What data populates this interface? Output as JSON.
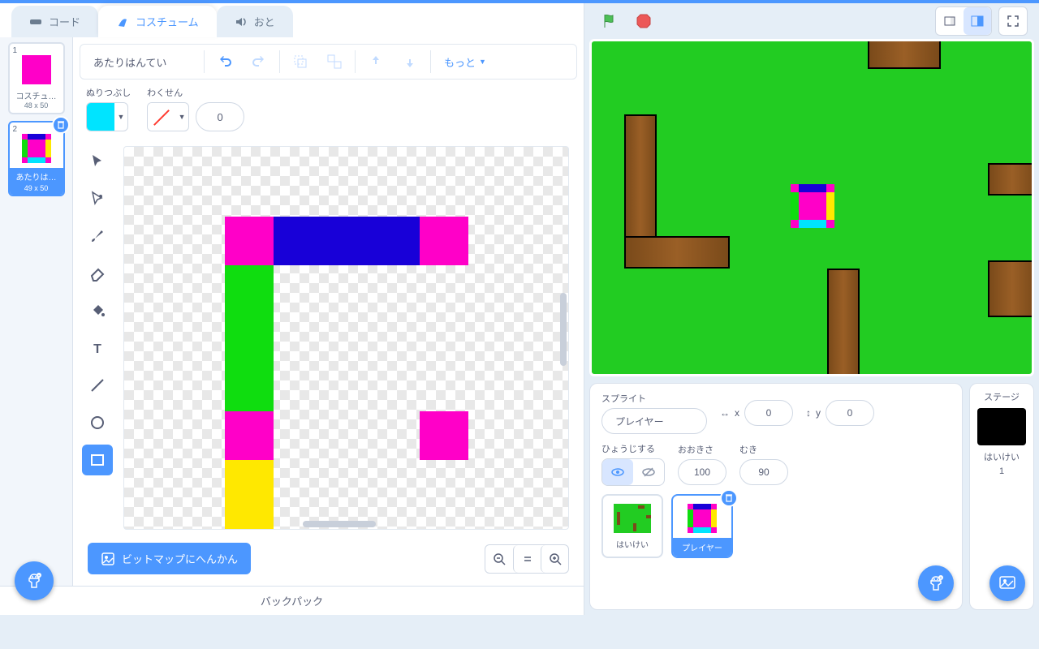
{
  "tabs": {
    "code": "コード",
    "costumes": "コスチューム",
    "sounds": "おと"
  },
  "costumeList": [
    {
      "num": "1",
      "name": "コスチュ…",
      "dim": "48 x 50"
    },
    {
      "num": "2",
      "name": "あたりは…",
      "dim": "49 x 50"
    }
  ],
  "editor": {
    "costumeName": "あたりはんてい",
    "fillLabel": "ぬりつぶし",
    "outlineLabel": "わくせん",
    "outlineWidth": "0",
    "moreLabel": "もっと",
    "bitmapLabel": "ビットマップにへんかん",
    "fillColor": "#00e4ff"
  },
  "stage": {
    "spriteLabel": "スプライト",
    "spriteName": "プレイヤー",
    "xLabel": "x",
    "yLabel": "y",
    "x": "0",
    "y": "0",
    "showLabel": "ひょうじする",
    "sizeLabel": "おおきさ",
    "size": "100",
    "directionLabel": "むき",
    "direction": "90"
  },
  "sprites": [
    {
      "name": "はいけい"
    },
    {
      "name": "プレイヤー"
    }
  ],
  "stagePanel": {
    "title": "ステージ",
    "backdropLabel": "はいけい",
    "backdropCount": "1"
  },
  "backpack": "バックパック"
}
